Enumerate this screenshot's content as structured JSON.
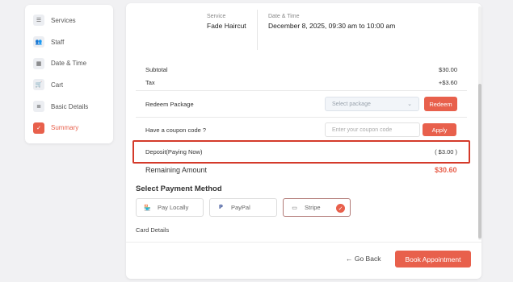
{
  "sidebar": {
    "items": [
      {
        "label": "Services",
        "icon": "list-icon"
      },
      {
        "label": "Staff",
        "icon": "users-icon"
      },
      {
        "label": "Date & Time",
        "icon": "calendar-icon"
      },
      {
        "label": "Cart",
        "icon": "cart-icon"
      },
      {
        "label": "Basic Details",
        "icon": "document-icon"
      },
      {
        "label": "Summary",
        "icon": "checkbox-icon",
        "active": true
      }
    ]
  },
  "booking": {
    "service_label": "Service",
    "service_value": "Fade Haircut",
    "datetime_label": "Date & Time",
    "datetime_value": "December 8, 2025, 09:30 am to 10:00 am"
  },
  "summary": {
    "subtotal_label": "Subtotal",
    "subtotal_value": "$30.00",
    "tax_label": "Tax",
    "tax_value": "+$3.60",
    "redeem_label": "Redeem Package",
    "redeem_placeholder": "Select package",
    "redeem_button": "Redeem",
    "coupon_label": "Have a coupon code ?",
    "coupon_placeholder": "Enter your coupon code",
    "apply_button": "Apply",
    "deposit_label": "Deposit(Paying Now)",
    "deposit_value": "( $3.00 )",
    "remaining_label": "Remaining Amount",
    "remaining_value": "$30.60"
  },
  "payment": {
    "title": "Select Payment Method",
    "methods": [
      {
        "label": "Pay Locally",
        "icon": "store-icon"
      },
      {
        "label": "PayPal",
        "icon": "paypal-icon"
      },
      {
        "label": "Stripe",
        "icon": "credit-card-icon",
        "selected": true
      }
    ],
    "card_details_label": "Card Details"
  },
  "footer": {
    "back_label": "← Go Back",
    "book_label": "Book Appointment"
  },
  "colors": {
    "accent": "#e8604c",
    "highlight_border": "#d43a2a"
  }
}
